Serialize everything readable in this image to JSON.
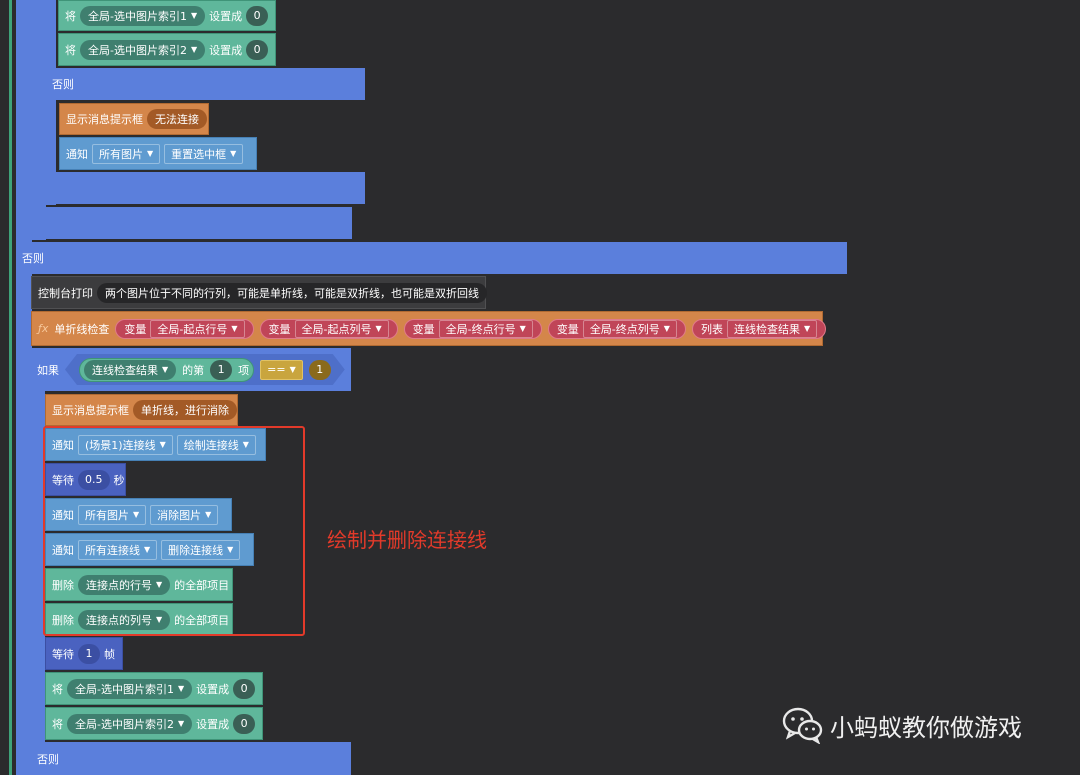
{
  "labels": {
    "set": "将",
    "set_to": "设置成",
    "else": "否则",
    "show_msg": "显示消息提示框",
    "notify": "通知",
    "console_print": "控制台打印",
    "fx_icon": "ƒx",
    "single_check": "单折线检查",
    "variable": "变量",
    "list": "列表",
    "if": "如果",
    "of_nth": "的第",
    "item": "项",
    "eq": "==",
    "wait": "等待",
    "seconds": "秒",
    "frames": "帧",
    "delete": "删除",
    "all_items": "的全部项目"
  },
  "top": {
    "set1_var": "全局-选中图片索引1",
    "set1_val": "0",
    "set2_var": "全局-选中图片索引2",
    "set2_val": "0",
    "msg_text": "无法连接",
    "notify_target": "所有图片",
    "notify_event": "重置选中框"
  },
  "console_text": "两个图片位于不同的行列，可能是单折线，可能是双折线，也可能是双折回线",
  "fx_args": [
    "全局-起点行号",
    "全局-起点列号",
    "全局-终点行号",
    "全局-终点列号"
  ],
  "fx_list": "连线检查结果",
  "if_block": {
    "list": "连线检查结果",
    "index": "1",
    "compare": "1"
  },
  "inner": {
    "msg_text": "单折线，进行消除",
    "notify1_target": "(场景1)连接线",
    "notify1_event": "绘制连接线",
    "wait_seconds": "0.5",
    "notify2_target": "所有图片",
    "notify2_event": "消除图片",
    "notify3_target": "所有连接线",
    "notify3_event": "删除连接线",
    "delete1_list": "连接点的行号",
    "delete2_list": "连接点的列号",
    "wait_frames": "1",
    "set1_var": "全局-选中图片索引1",
    "set1_val": "0",
    "set2_var": "全局-选中图片索引2",
    "set2_val": "0"
  },
  "annotation": {
    "text": "绘制并删除连接线",
    "color": "#e23a2a"
  },
  "watermark": {
    "text": "小蚂蚁教你做游戏"
  },
  "colors": {
    "background": "#2b2b2d",
    "control_blue": "#5b7fdc",
    "data_teal": "#5fb79b",
    "event_sky": "#5f9bd0",
    "looks_orange": "#d4864a",
    "function_red": "#db5a6e"
  }
}
